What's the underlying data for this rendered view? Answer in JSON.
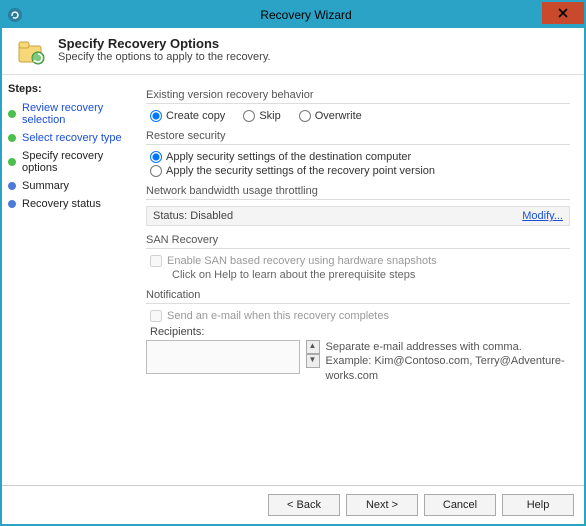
{
  "window": {
    "title": "Recovery Wizard"
  },
  "header": {
    "title": "Specify Recovery Options",
    "subtitle": "Specify the options to apply to the recovery."
  },
  "steps": {
    "title": "Steps:",
    "items": [
      {
        "label": "Review recovery selection"
      },
      {
        "label": "Select recovery type"
      },
      {
        "label": "Specify recovery options"
      },
      {
        "label": "Summary"
      },
      {
        "label": "Recovery status"
      }
    ]
  },
  "existing": {
    "title": "Existing version recovery behavior",
    "options": {
      "create": "Create copy",
      "skip": "Skip",
      "overwrite": "Overwrite"
    }
  },
  "security": {
    "title": "Restore security",
    "dest": "Apply security settings of the destination computer",
    "rpv": "Apply the security settings of the recovery point version"
  },
  "throttle": {
    "title": "Network bandwidth usage throttling",
    "status": "Status: Disabled",
    "modify": "Modify..."
  },
  "san": {
    "title": "SAN Recovery",
    "enable": "Enable SAN based recovery using hardware snapshots",
    "hint": "Click on Help to learn about the prerequisite steps"
  },
  "notify": {
    "title": "Notification",
    "send": "Send an e-mail when this recovery completes",
    "recipients_label": "Recipients:",
    "recipients_value": "",
    "hint1": "Separate e-mail addresses with comma.",
    "hint2": "Example: Kim@Contoso.com, Terry@Adventure-works.com"
  },
  "buttons": {
    "back": "< Back",
    "next": "Next >",
    "cancel": "Cancel",
    "help": "Help"
  }
}
